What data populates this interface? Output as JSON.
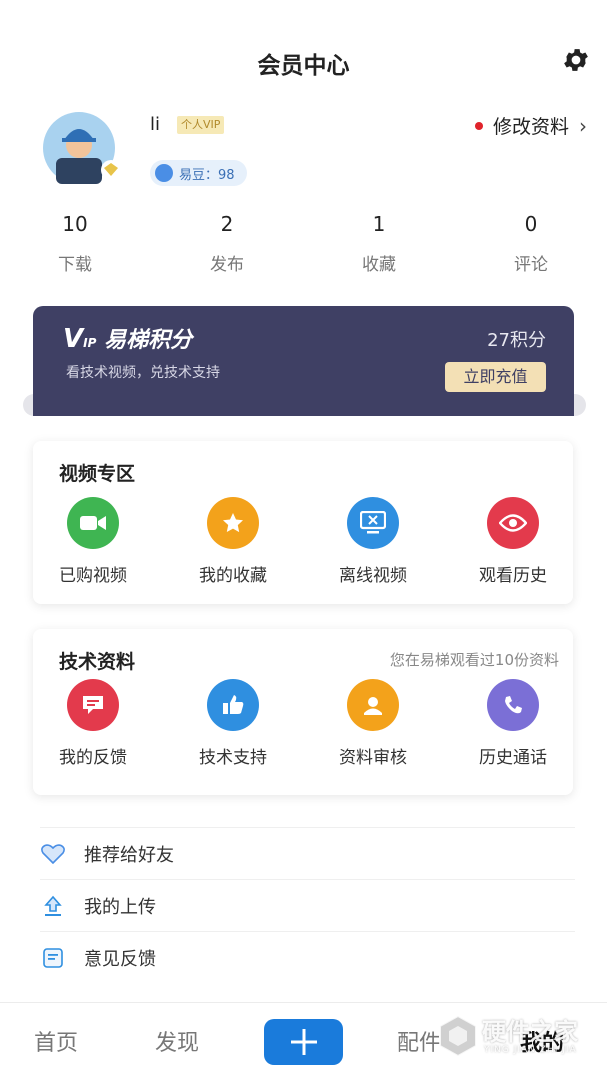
{
  "header": {
    "title": "会员中心",
    "settings_icon": "gear-icon"
  },
  "profile": {
    "username": "li",
    "vip_tag": "个人VIP",
    "edit_label": "修改资料",
    "beans_text": "易豆：98"
  },
  "stats": [
    {
      "value": "10",
      "label": "下载"
    },
    {
      "value": "2",
      "label": "发布"
    },
    {
      "value": "1",
      "label": "收藏"
    },
    {
      "value": "0",
      "label": "评论"
    }
  ],
  "vip_card": {
    "logo_v": "V",
    "logo_ip": "IP",
    "title": "易梯积分",
    "subtitle": "看技术视频，兑技术支持",
    "points": "27积分",
    "recharge_label": "立即充值"
  },
  "video_section": {
    "title": "视频专区",
    "items": [
      {
        "label": "已购视频",
        "icon": "video-camera-icon",
        "color": "#3fb552"
      },
      {
        "label": "我的收藏",
        "icon": "star-icon",
        "color": "#f3a21b"
      },
      {
        "label": "离线视频",
        "icon": "monitor-icon",
        "color": "#2f8fe0"
      },
      {
        "label": "观看历史",
        "icon": "eye-icon",
        "color": "#e33a4c"
      }
    ]
  },
  "tech_section": {
    "title": "技术资料",
    "note": "您在易梯观看过10份资料",
    "items": [
      {
        "label": "我的反馈",
        "icon": "message-icon",
        "color": "#e33a4c"
      },
      {
        "label": "技术支持",
        "icon": "thumbs-up-icon",
        "color": "#2f8fe0"
      },
      {
        "label": "资料审核",
        "icon": "user-badge-icon",
        "color": "#f3a21b"
      },
      {
        "label": "历史通话",
        "icon": "phone-icon",
        "color": "#7b6fd6"
      }
    ]
  },
  "menu": [
    {
      "label": "推荐给好友",
      "icon": "heart-icon"
    },
    {
      "label": "我的上传",
      "icon": "upload-icon"
    },
    {
      "label": "意见反馈",
      "icon": "feedback-icon"
    }
  ],
  "tabbar": {
    "home": "首页",
    "discover": "发现",
    "plus_icon": "plus-icon",
    "parts": "配件",
    "mine": "我的"
  },
  "watermark": {
    "title": "硬件之家",
    "subtitle": "YING JIAN ZHI JIA"
  },
  "colors": {
    "accent": "#1a7bdb",
    "vip_bg": "#3f4064",
    "recharge_bg": "#f3e0b5"
  }
}
